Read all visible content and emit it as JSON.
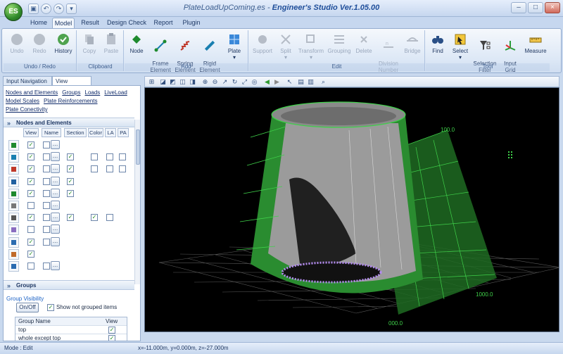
{
  "window": {
    "doc_title": "PlateLoadUpComing.es",
    "separator": " - ",
    "app_title": "Engineer's Studio Ver.1.05.00",
    "logo_text": "ES"
  },
  "ribbon_tabs": [
    "Home",
    "Model",
    "Result",
    "Design Check",
    "Report",
    "Plugin"
  ],
  "ribbon": {
    "undo_redo": {
      "label": "Undo / Redo",
      "buttons": [
        "Undo",
        "Redo",
        "History"
      ]
    },
    "clipboard": {
      "label": "Clipboard",
      "buttons": [
        "Copy",
        "Paste"
      ]
    },
    "add": {
      "label": "Add",
      "buttons": [
        "Node",
        "Frame\nElement",
        "Spring\nElement",
        "Rigid\nElement",
        "Plate"
      ]
    },
    "edit": {
      "label": "Edit",
      "buttons": [
        "Support",
        "Split",
        "Transform",
        "Grouping",
        "Delete",
        "Division\nNumber",
        "Bridge"
      ]
    },
    "tool": {
      "label": "Tool",
      "buttons": [
        "Find",
        "Select",
        "Selection\nFilter",
        "Input\nGrid",
        "Measure"
      ]
    }
  },
  "left_tabs": [
    "Input Navigation",
    "View Settings"
  ],
  "view_links": [
    "Nodes and Elements",
    "Groups",
    "Loads",
    "LiveLoad",
    "Model Scales",
    "Plate Reinforcements",
    "Plate Conectivity"
  ],
  "nodes_section": {
    "title": "Nodes and Elements",
    "columns": [
      "View",
      "Name",
      "Section",
      "Color",
      "LA",
      "PA"
    ],
    "rows": [
      {
        "icon": "node-icon",
        "view": true,
        "name": false,
        "dots": true,
        "section": null,
        "color": null,
        "la": null,
        "pa": null
      },
      {
        "icon": "frame-element-icon",
        "view": true,
        "name": false,
        "dots": true,
        "section": true,
        "color": false,
        "la": false,
        "pa": false
      },
      {
        "icon": "spring-element-icon",
        "view": true,
        "name": false,
        "dots": true,
        "section": true,
        "color": false,
        "la": false,
        "pa": false
      },
      {
        "icon": "rigid-element-icon",
        "view": true,
        "name": false,
        "dots": true,
        "section": true,
        "color": null,
        "la": null,
        "pa": null
      },
      {
        "icon": "link-element-icon",
        "view": true,
        "name": false,
        "dots": true,
        "section": true,
        "color": null,
        "la": null,
        "pa": null
      },
      {
        "icon": "cable-element-icon",
        "view": false,
        "name": false,
        "dots": true,
        "section": null,
        "color": null,
        "la": null,
        "pa": null
      },
      {
        "icon": "plate-element-icon",
        "view": true,
        "name": false,
        "dots": true,
        "section": true,
        "color": true,
        "la": false,
        "pa": null
      },
      {
        "icon": "solid-element-icon",
        "view": false,
        "name": false,
        "dots": true,
        "section": null,
        "color": null,
        "la": null,
        "pa": null
      },
      {
        "icon": "support-icon",
        "view": true,
        "name": false,
        "dots": true,
        "section": null,
        "color": null,
        "la": null,
        "pa": null
      },
      {
        "icon": "mesh-icon",
        "view": true,
        "name": null,
        "dots": false,
        "section": null,
        "color": null,
        "la": null,
        "pa": null
      },
      {
        "icon": "connectivity-icon",
        "view": false,
        "name": false,
        "dots": true,
        "section": null,
        "color": null,
        "la": null,
        "pa": null
      }
    ]
  },
  "groups_section": {
    "title": "Groups",
    "visibility_label": "Group Visibility",
    "onoff_label": "On/Off",
    "show_not_grouped_label": "Show not grouped items",
    "show_not_grouped": true,
    "table_headers": [
      "Group Name",
      "View"
    ],
    "rows": [
      {
        "name": "top",
        "view": true
      },
      {
        "name": "whole except top",
        "view": true
      }
    ]
  },
  "viewport": {
    "label_top": "100.0",
    "label_right": "1000.0",
    "label_bottom": "000.0",
    "colors": {
      "background": "#000000",
      "mesh": "#2fbf3a",
      "surface": "#9c9c9c",
      "grid": "#5a5a5a",
      "ring": "#b48cf0"
    }
  },
  "status": {
    "mode": "Mode : Edit",
    "coords": "x=-11.000m, y=0.000m, z=-27.000m"
  }
}
